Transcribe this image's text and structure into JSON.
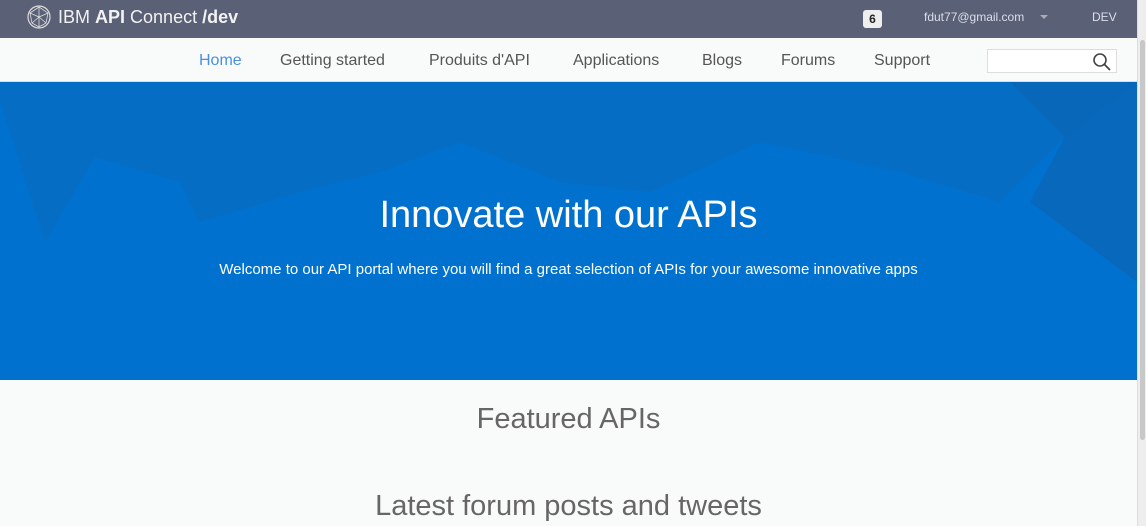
{
  "header": {
    "brand_prefix": "IBM ",
    "brand_bold": "API",
    "brand_mid": " Connect ",
    "brand_suffix": "/dev",
    "notifications": "6",
    "user": "fdut77@gmail.com",
    "env": "DEV",
    "bg": "#5a6075"
  },
  "nav": {
    "items": [
      {
        "label": "Home",
        "active": true
      },
      {
        "label": "Getting started"
      },
      {
        "label": "Produits d'API"
      },
      {
        "label": "Applications"
      },
      {
        "label": "Blogs"
      },
      {
        "label": "Forums"
      },
      {
        "label": "Support"
      }
    ],
    "search_value": "",
    "active_color": "#4a90e2"
  },
  "hero": {
    "title": "Innovate with our APIs",
    "subtitle": "Welcome to our API portal where you will find a great selection of APIs for your awesome innovative apps",
    "bg": "#0071ce"
  },
  "sections": {
    "featured": "Featured APIs",
    "latest": "Latest forum posts and tweets"
  }
}
